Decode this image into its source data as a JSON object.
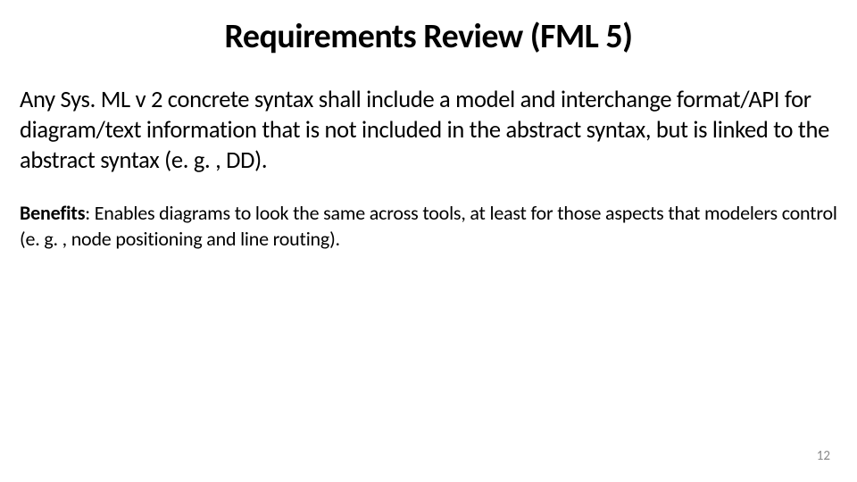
{
  "slide": {
    "title": "Requirements Review (FML 5)",
    "body": "Any Sys. ML v 2 concrete syntax shall include a model and interchange format/API for diagram/text information that is not included in the abstract syntax, but is linked to the abstract syntax (e. g. , DD).",
    "benefits_label": "Benefits",
    "benefits_text": ": Enables diagrams to look the same across tools, at least for those aspects that modelers control (e. g. , node positioning and line routing).",
    "page_number": "12"
  }
}
